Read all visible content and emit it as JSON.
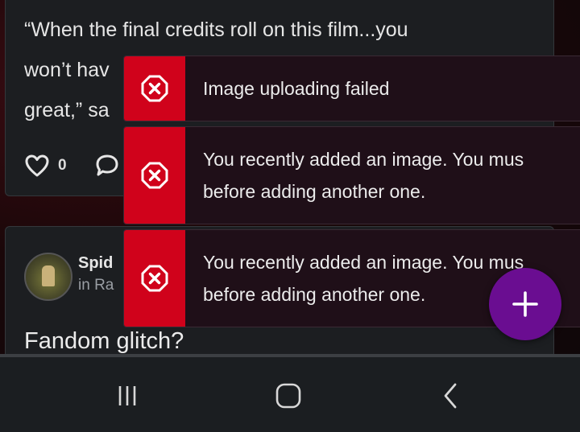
{
  "post1": {
    "quote": "“When the final credits roll on this film...you\nwon’t hav\ngreat,” sa",
    "like_count": "0"
  },
  "post2": {
    "author": "Spid",
    "community": "in Ra",
    "title": "Fandom glitch?"
  },
  "toasts": [
    {
      "message": "Image uploading failed",
      "icon": "error-x-icon"
    },
    {
      "message": "You recently added an image. You mus\nbefore adding another one.",
      "icon": "error-x-icon"
    },
    {
      "message": "You recently added an image. You mus\nbefore adding another one.",
      "icon": "error-x-icon"
    }
  ],
  "colors": {
    "error": "#d0021b",
    "fab": "#6a0d91",
    "toast_bg": "#1f0f18",
    "card_bg": "#1c1e21"
  }
}
